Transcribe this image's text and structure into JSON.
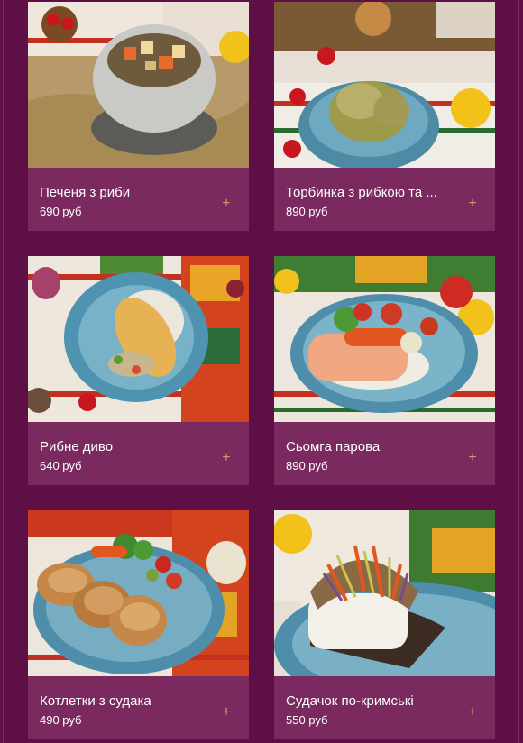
{
  "menu": {
    "items": [
      {
        "title": "Печеня з риби",
        "price": "690 руб",
        "icon": "plus-icon",
        "image": "fish-stew-pot"
      },
      {
        "title": "Торбинка з рибкою та ...",
        "price": "890 руб",
        "icon": "plus-icon",
        "image": "fish-pouch-pancake"
      },
      {
        "title": "Рибне диво",
        "price": "640 руб",
        "icon": "plus-icon",
        "image": "fish-fillet-sauce"
      },
      {
        "title": "Сьомга парова",
        "price": "890 руб",
        "icon": "plus-icon",
        "image": "steamed-salmon"
      },
      {
        "title": "Котлетки з судака",
        "price": "490 руб",
        "icon": "plus-icon",
        "image": "pike-perch-cutlets"
      },
      {
        "title": "Судачок по-кримські",
        "price": "550 руб",
        "icon": "plus-icon",
        "image": "pike-perch-crimean"
      }
    ]
  },
  "colors": {
    "page_background": "#5e0f46",
    "card_background": "#7a2a5e",
    "text": "#ffffff",
    "accent_plus": "#c9a06a"
  }
}
